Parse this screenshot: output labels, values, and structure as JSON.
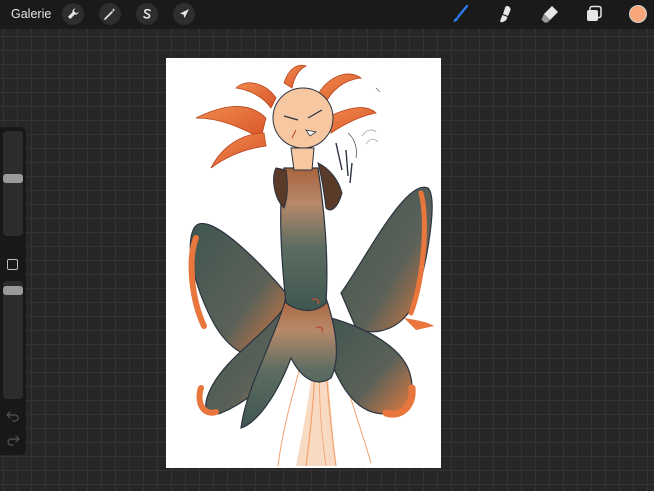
{
  "toolbar": {
    "gallery_label": "Galerie",
    "left_tools": [
      {
        "icon": "wrench-icon",
        "name": "actions"
      },
      {
        "icon": "magic-wand-icon",
        "name": "adjustments"
      },
      {
        "icon": "selection-icon",
        "name": "selection"
      },
      {
        "icon": "arrow-cursor-icon",
        "name": "transform"
      }
    ],
    "right_tools": [
      {
        "icon": "brush-icon",
        "name": "brush",
        "active": true
      },
      {
        "icon": "smudge-icon",
        "name": "smudge"
      },
      {
        "icon": "eraser-icon",
        "name": "eraser"
      },
      {
        "icon": "layers-icon",
        "name": "layers"
      }
    ],
    "active_color": "#f7a77a",
    "accent_color": "#2f7cf6"
  },
  "sidebar": {
    "brush_size_level": 0.55,
    "opacity_level": 0.05,
    "modify_icon": "square-icon",
    "undo_icon": "undo-arrow-icon",
    "redo_icon": "redo-arrow-icon"
  },
  "canvas": {
    "background": "#ffffff",
    "colors": {
      "orange": "#e8763d",
      "peach": "#f7c7a1",
      "dark_teal": "#3f5650",
      "brown": "#7a4a30",
      "line": "#2b3340"
    }
  }
}
